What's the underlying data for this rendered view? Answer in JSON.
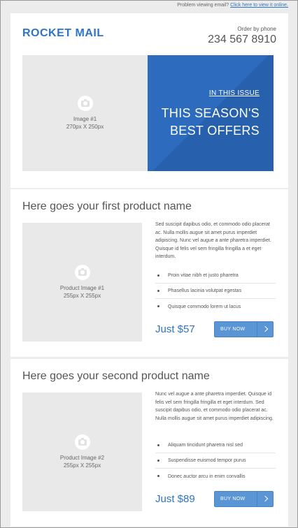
{
  "preheader": {
    "text": "Problem viewing email?",
    "link": "Click here to view it online."
  },
  "header": {
    "logo": "ROCKET MAIL",
    "phone_label": "Order by phone",
    "phone": "234 567 8910"
  },
  "hero": {
    "image_label": "Image #1",
    "image_size": "270px X 250px",
    "kicker": "IN THIS ISSUE",
    "title_line1": "THIS SEASON'S",
    "title_line2": "BEST OFFERS"
  },
  "products": [
    {
      "title": "Here goes your first product name",
      "image_label": "Product Image #1",
      "image_size": "255px X 255px",
      "description": "Sed suscipit dapibus odio, et commodo odio placerat ac. Nulla mollis augue sit amet purus imperdiet adipiscing. Nunc vel augue a ante pharetra imperdiet. Quisque id felis vel sem fringilla fringilla a et eget interdum.",
      "features": [
        "Proin vitae nibh et justo pharetra",
        "Phasellus lacinia volutpat egestas",
        "Quisque commodo lorem ut lacus"
      ],
      "price": "Just $57",
      "button": "BUY NOW"
    },
    {
      "title": "Here goes your second product name",
      "image_label": "Product Image #2",
      "image_size": "255px X 255px",
      "description": "Nunc vel augue a ante pharetra imperdiet. Quisque id felis vel sem fringilla fringilla et eget interdum. Sed suscipit dapibus odio, et commodo odio placerat ac. Nulla mollis augue sit amet purus imperdiet adipiscing.",
      "features": [
        "Aliquam tincidunt pharetra nisl sed",
        "Suspendisse euismod tempor purus",
        "Donec auctor arcu in enim convallis"
      ],
      "price": "Just $89",
      "button": "BUY NOW"
    }
  ],
  "colors": {
    "brand": "#2f74c4",
    "hero_bg": "#2c6bbd",
    "button_bg": "#5a95d6"
  }
}
